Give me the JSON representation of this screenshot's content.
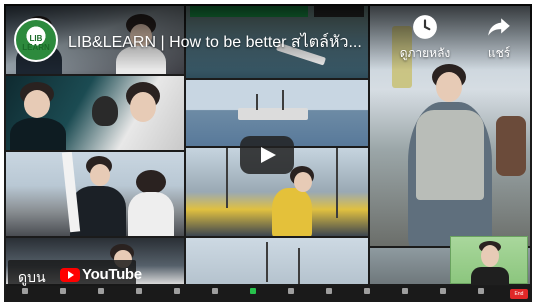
{
  "video": {
    "title": "LIB&LEARN | How to be better สไตล์หัว...",
    "channel_avatar_text": "LIB LEARN"
  },
  "actions": {
    "watch_later": "ดูภายหลัง",
    "share": "แชร์"
  },
  "overlay": {
    "watch_on_label": "ดูบน",
    "youtube_word": "YouTube"
  },
  "zoom": {
    "info_bar_text": "",
    "view_label": "",
    "toolbar": [
      {
        "label": ""
      },
      {
        "label": ""
      },
      {
        "label": ""
      },
      {
        "label": ""
      },
      {
        "label": ""
      },
      {
        "label": ""
      },
      {
        "label": ""
      },
      {
        "label": ""
      },
      {
        "label": ""
      },
      {
        "label": ""
      },
      {
        "label": ""
      },
      {
        "label": ""
      },
      {
        "label": ""
      }
    ],
    "end_label": "End"
  },
  "colors": {
    "youtube_red": "#ff0000",
    "zoom_green": "#1aa14d",
    "end_red": "#e02828"
  }
}
